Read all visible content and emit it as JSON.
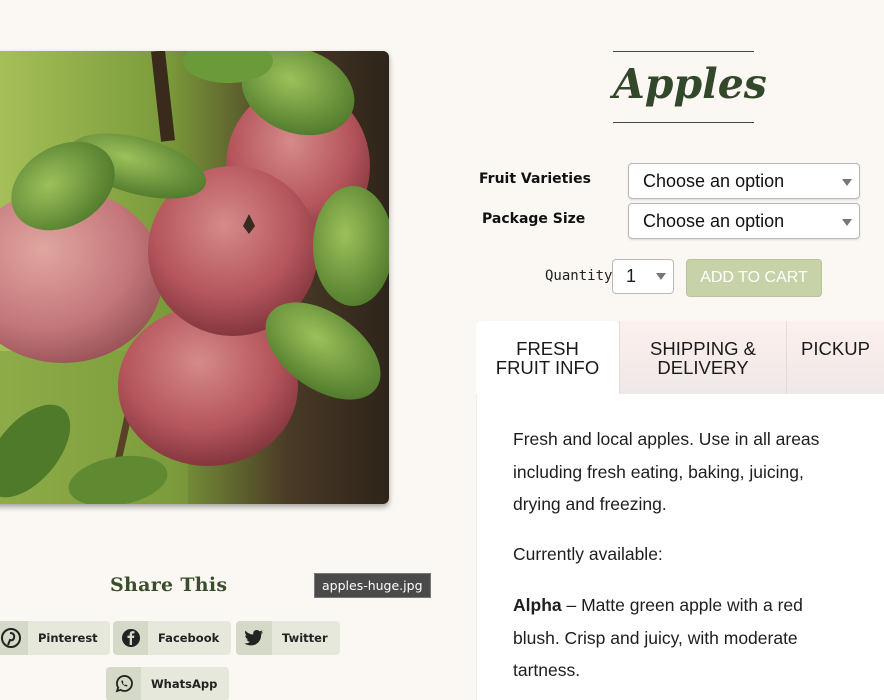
{
  "product": {
    "title": "Apples",
    "image_alt": "apples-huge.jpg"
  },
  "options": {
    "variety_label": "Fruit Varieties",
    "variety_value": "Choose an option",
    "package_label": "Package Size",
    "package_value": "Choose an option",
    "quantity_label": "Quantity:",
    "quantity_value": "1",
    "add_to_cart_label": "ADD TO CART"
  },
  "tabs": [
    {
      "line1": "FRESH",
      "line2": "FRUIT INFO"
    },
    {
      "line1": "SHIPPING &",
      "line2": "DELIVERY"
    },
    {
      "line1": "PICKUP",
      "line2": ""
    }
  ],
  "panel": {
    "intro": "Fresh and local apples. Use in all areas including fresh eating, baking, juicing, drying and freezing.",
    "available": "Currently available:",
    "variety_name": "Alpha",
    "variety_desc": " – Matte green apple with a red blush. Crisp and juicy, with moderate tartness."
  },
  "share": {
    "title": "Share This",
    "buttons": [
      {
        "label": "Pinterest",
        "icon": "pinterest-icon"
      },
      {
        "label": "Facebook",
        "icon": "facebook-icon"
      },
      {
        "label": "Twitter",
        "icon": "twitter-icon"
      },
      {
        "label": "WhatsApp",
        "icon": "whatsapp-icon"
      }
    ]
  },
  "colors": {
    "title_green": "#33472a",
    "add_to_cart_bg": "#c7d2a8",
    "page_bg": "#fbf8f3",
    "tooltip_bg": "#4a4a4a"
  }
}
